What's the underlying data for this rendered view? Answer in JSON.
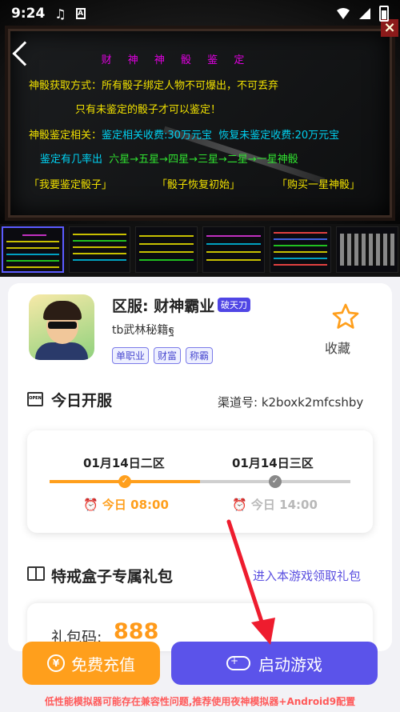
{
  "status": {
    "time": "9:24"
  },
  "hero": {
    "title": "财 神 神 骰 鉴 定",
    "line1_label": "神骰获取方式：",
    "line1_text": "所有骰子绑定人物不可爆出，不可丢弃",
    "line2": "只有未鉴定的骰子才可以鉴定！",
    "line3_label": "神骰鉴定相关：",
    "line3_cost": "鉴定相关收费:30万元宝",
    "line3_restore": "恢复未鉴定收费:20万元宝",
    "line4_label": "鉴定有几率出",
    "line4_text": "六星→五星→四星→三星→二星→一星神骰",
    "link1": "「我要鉴定骰子」",
    "link2": "「骰子恢复初始」",
    "link3": "「购买一星神骰」"
  },
  "game": {
    "server": "区服: 财神霸业",
    "badge": "破天刀",
    "subtitle": "tb武林秘籍ฐ",
    "tags": [
      "单职业",
      "财富",
      "称霸"
    ],
    "favorite_label": "收藏"
  },
  "today": {
    "title": "今日开服",
    "icon_text": "OPEN",
    "channel": "渠道号: k2boxk2mfcshby",
    "servers": [
      {
        "name": "01月14日二区",
        "time": "今日 08:00",
        "status": "active"
      },
      {
        "name": "01月14日三区",
        "time": "今日 14:00",
        "status": "pending"
      }
    ]
  },
  "gift": {
    "title": "特戒盒子专属礼包",
    "link": "进入本游戏领取礼包",
    "code_label": "礼包码:",
    "code_value": "888"
  },
  "actions": {
    "free_recharge": "免费充值",
    "start_game": "启动游戏"
  },
  "warning": "低性能模拟器可能存在兼容性问题,推荐使用夜神模拟器+Android9配置",
  "colors": {
    "accent": "#5b53ea",
    "orange": "#ff9f1c",
    "warning": "#ff5a5a"
  }
}
